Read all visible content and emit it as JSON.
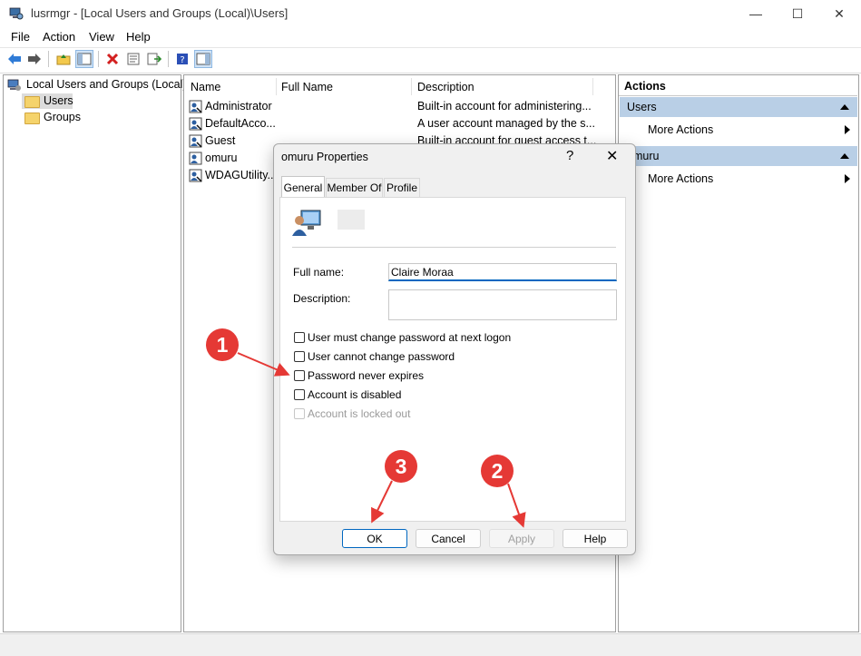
{
  "window": {
    "title": "lusrmgr - [Local Users and Groups (Local)\\Users]",
    "minimize": "—",
    "maximize": "☐",
    "close": "✕"
  },
  "menu": [
    "File",
    "Action",
    "View",
    "Help"
  ],
  "toolbar_icons": [
    "back-arrow-icon",
    "forward-arrow-icon",
    "up-folder-icon",
    "show-hide-tree-icon",
    "delete-icon",
    "properties-icon",
    "export-list-icon",
    "help-icon",
    "show-hide-action-pane-icon"
  ],
  "tree": {
    "root": "Local Users and Groups (Local)",
    "items": [
      "Users",
      "Groups"
    ]
  },
  "list": {
    "columns": [
      "Name",
      "Full Name",
      "Description"
    ],
    "rows": [
      {
        "name": "Administrator",
        "full_name": "",
        "description": "Built-in account for administering..."
      },
      {
        "name": "DefaultAcco...",
        "full_name": "",
        "description": "A user account managed by the s..."
      },
      {
        "name": "Guest",
        "full_name": "",
        "description": "Built-in account for guest access t..."
      },
      {
        "name": "omuru",
        "full_name": "",
        "description": ""
      },
      {
        "name": "WDAGUtility...",
        "full_name": "",
        "description": ""
      }
    ]
  },
  "actions": {
    "header": "Actions",
    "sections": [
      {
        "title": "Users",
        "item": "More Actions"
      },
      {
        "title": "omuru",
        "item": "More Actions"
      }
    ]
  },
  "dialog": {
    "title": "omuru Properties",
    "help": "?",
    "close": "✕",
    "tabs": [
      "General",
      "Member Of",
      "Profile"
    ],
    "full_name_label": "Full name:",
    "full_name_value": "Claire Moraa",
    "description_label": "Description:",
    "description_value": "",
    "checkboxes": [
      {
        "label": "User must change password at next logon",
        "checked": false,
        "disabled": false
      },
      {
        "label": "User cannot change password",
        "checked": false,
        "disabled": false
      },
      {
        "label": "Password never expires",
        "checked": false,
        "disabled": false
      },
      {
        "label": "Account is disabled",
        "checked": false,
        "disabled": false
      },
      {
        "label": "Account is locked out",
        "checked": false,
        "disabled": true
      }
    ],
    "buttons": {
      "ok": "OK",
      "cancel": "Cancel",
      "apply": "Apply",
      "help": "Help"
    }
  },
  "annotations": [
    "1",
    "2",
    "3"
  ],
  "colors": {
    "annotation_red": "#e53935",
    "section_blue": "#b9cfe6",
    "default_button_border": "#0067c0"
  }
}
